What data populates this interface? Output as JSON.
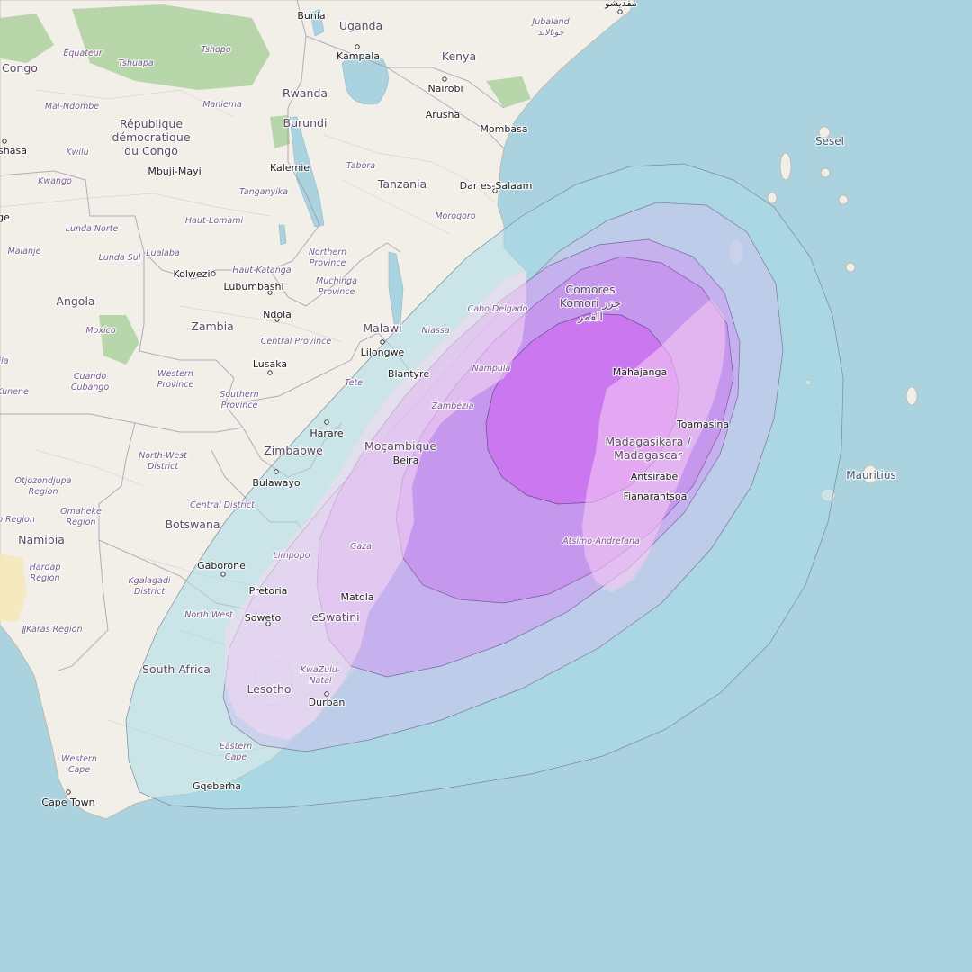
{
  "map": {
    "countries": {
      "uganda": "Uganda",
      "kenya": "Kenya",
      "rwanda": "Rwanda",
      "burundi": "Burundi",
      "congo": "Congo",
      "drc_line1": "République",
      "drc_line2": "démocratique",
      "drc_line3": "du Congo",
      "tanzania": "Tanzania",
      "angola": "Angola",
      "zambia": "Zambia",
      "malawi": "Malawi",
      "zimbabwe": "Zimbabwe",
      "mozambique": "Moçambique",
      "botswana": "Botswana",
      "namibia": "Namibia",
      "south_africa": "South Africa",
      "lesotho": "Lesotho",
      "eswatini": "eSwatini",
      "comores_line1": "Comores",
      "comores_line2": "Komori جزر",
      "comores_line3": "القمر",
      "madagascar_line1": "Madagasikara /",
      "madagascar_line2": "Madagascar",
      "seychelles": "Sesel",
      "mauritius": "Mauritius"
    },
    "regions": {
      "jubaland_line1": "Jubaland",
      "jubaland_line2": "جوبالاند",
      "equateur": "Équateur",
      "tshopo": "Tshopo",
      "tshuapa": "Tshuapa",
      "maniema": "Maniema",
      "mai_ndombe": "Mai-Ndombe",
      "kwilu": "Kwilu",
      "kwango": "Kwango",
      "tanganyika": "Tanganyika",
      "tabora": "Tabora",
      "morogoro": "Morogoro",
      "haut_lomami": "Haut-Lomami",
      "lunda_norte": "Lunda Norte",
      "lunda_sul": "Lunda Sul",
      "lualaba": "Lualaba",
      "malanje": "Malanje",
      "haut_katanga": "Haut-Katanga",
      "northern_line1": "Northern",
      "northern_line2": "Province",
      "muchinga_line1": "Muchinga",
      "muchinga_line2": "Province",
      "niassa": "Niassa",
      "cabo_delgado": "Cabo Delgado",
      "nampula": "Nampula",
      "moxico": "Moxico",
      "central_province": "Central Province",
      "western_line1": "Western",
      "western_line2": "Province",
      "southern_line1": "Southern",
      "southern_line2": "Province",
      "cuando_line1": "Cuando",
      "cuando_line2": "Cubango",
      "kunene": "Kunene",
      "tete": "Tete",
      "zambezia": "Zambézia",
      "north_west_district_line1": "North-West",
      "north_west_district_line2": "District",
      "otjozondjupa_line1": "Otjozondjupa",
      "otjozondjupa_line2": "Region",
      "omaheke_line1": "Omaheke",
      "omaheke_line2": "Region",
      "erongo": "o Region",
      "central_district": "Central District",
      "hardap_line1": "Hardap",
      "hardap_line2": "Region",
      "kgalagadi_line1": "Kgalagadi",
      "kgalagadi_line2": "District",
      "limpopo": "Limpopo",
      "gaza": "Gaza",
      "north_west": "North West",
      "ilkaras": "ǁKaras Region",
      "kzn_line1": "KwaZulu-",
      "kzn_line2": "Natal",
      "eastern_cape_line1": "Eastern",
      "eastern_cape_line2": "Cape",
      "western_cape_line1": "Western",
      "western_cape_line2": "Cape",
      "atsimo": "Atsimo-Andrefana",
      "ila": "ila"
    },
    "cities": {
      "bunia": "Bunia",
      "kampala": "Kampala",
      "nairobi": "Nairobi",
      "arusha": "Arusha",
      "mombasa": "Mombasa",
      "mogadishu": "مقديشو",
      "kinshasa": "shasa",
      "mbuji_mayi": "Mbuji-Mayi",
      "kalemie": "Kalemie",
      "dar_es_salaam": "Dar es-Salaam",
      "kolwezi": "Kolwezi",
      "lubumbashi": "Lubumbashi",
      "ndola": "Ndola",
      "lilongwe": "Lilongwe",
      "lusaka": "Lusaka",
      "blantyre": "Blantyre",
      "harare": "Harare",
      "beira": "Beira",
      "bulawayo": "Bulawayo",
      "gaborone": "Gaborone",
      "pretoria": "Pretoria",
      "soweto": "Soweto",
      "matola": "Matola",
      "durban": "Durban",
      "gqeberha": "Gqeberha",
      "cape_town": "Cape Town",
      "mahajanga": "Mahajanga",
      "toamasina": "Toamasina",
      "antsirabe": "Antsirabe",
      "fianarantsoa": "Fianarantsoa",
      "luanda_edge": "ge"
    },
    "coverage_colors": {
      "outer": "#a9dbe6",
      "ring2": "#c7c6ec",
      "ring3": "#c7a5ee",
      "ring4": "#c690ee",
      "core": "#cc6ff0",
      "mainland_overlay": "#f7d8f3"
    }
  }
}
